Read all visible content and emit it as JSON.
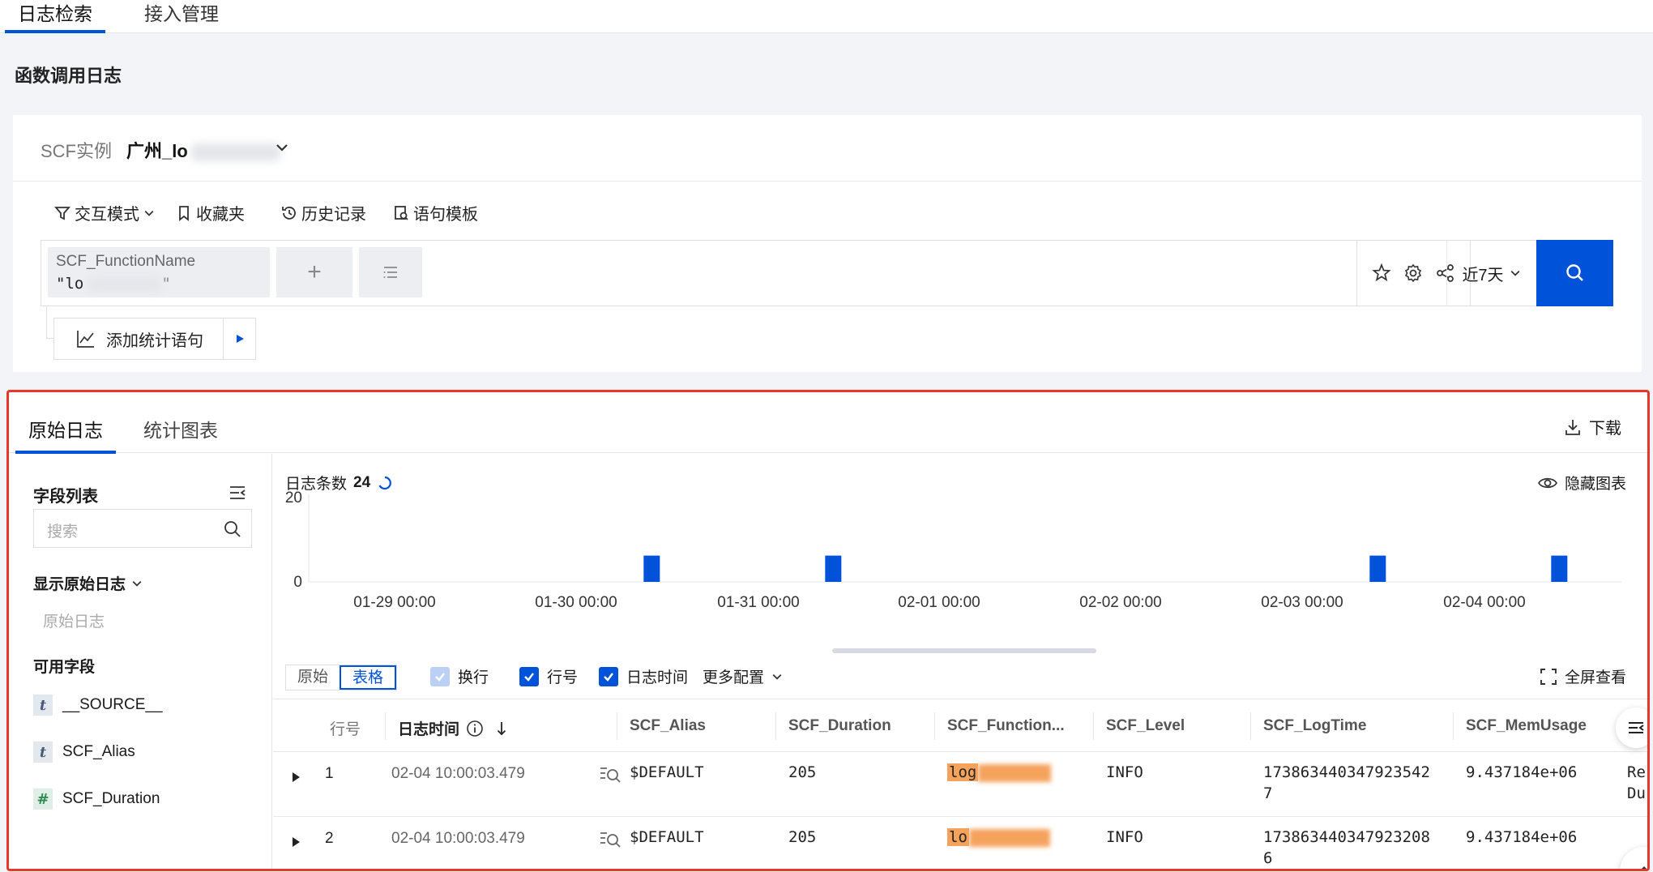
{
  "top_tabs": [
    {
      "label": "日志检索",
      "active": true
    },
    {
      "label": "接入管理",
      "active": false
    }
  ],
  "page_title": "函数调用日志",
  "instance": {
    "label": "SCF实例",
    "value": "广州_lo"
  },
  "toolbar": {
    "mode": "交互模式",
    "favorites": "收藏夹",
    "history": "历史记录",
    "templates": "语句模板"
  },
  "query": {
    "field_name": "SCF_FunctionName",
    "field_value": "\"lo",
    "add_symbol": "+",
    "time_range": "近7天",
    "add_stats": "添加统计语句"
  },
  "result_tabs": [
    {
      "label": "原始日志",
      "active": true
    },
    {
      "label": "统计图表",
      "active": false
    }
  ],
  "download": "下载",
  "sidebar": {
    "title": "字段列表",
    "search_placeholder": "搜索",
    "show_raw": "显示原始日志",
    "raw_log": "原始日志",
    "available": "可用字段",
    "fields": [
      {
        "type": "t",
        "name": "__SOURCE__"
      },
      {
        "type": "t",
        "name": "SCF_Alias"
      },
      {
        "type": "#",
        "name": "SCF_Duration"
      }
    ]
  },
  "summary": {
    "label": "日志条数",
    "count": "24"
  },
  "hide_chart": "隐藏图表",
  "chart_data": {
    "type": "bar",
    "y_ticks": [
      "20",
      "0"
    ],
    "ylim": [
      0,
      20
    ],
    "x_ticks": [
      "01-29 00:00",
      "01-30 00:00",
      "01-31 00:00",
      "02-01 00:00",
      "02-02 00:00",
      "02-03 00:00",
      "02-04 00:00"
    ],
    "bars": [
      {
        "x": "01-30 10:00",
        "value": 6
      },
      {
        "x": "01-31 10:00",
        "value": 6
      },
      {
        "x": "02-03 10:00",
        "value": 6
      },
      {
        "x": "02-04 10:00",
        "value": 6
      }
    ],
    "color": "#0052d9"
  },
  "view_options": {
    "raw": "原始",
    "table": "表格",
    "wrap": "换行",
    "line_no": "行号",
    "log_time": "日志时间",
    "more": "更多配置",
    "fullscreen": "全屏查看"
  },
  "table": {
    "columns": [
      "行号",
      "日志时间",
      "SCF_Alias",
      "SCF_Duration",
      "SCF_Function...",
      "SCF_Level",
      "SCF_LogTime",
      "SCF_MemUsage"
    ],
    "rows": [
      {
        "no": "1",
        "time": "02-04 10:00:03.479",
        "alias": "$DEFAULT",
        "duration": "205",
        "function": "log",
        "level": "INFO",
        "logtime_1": "173863440347923542",
        "logtime_2": "7",
        "mem": "9.437184e+06",
        "extra_1": "Re",
        "extra_2": "Du"
      },
      {
        "no": "2",
        "time": "02-04 10:00:03.479",
        "alias": "$DEFAULT",
        "duration": "205",
        "function": "lo",
        "level": "INFO",
        "logtime_1": "173863440347923208",
        "logtime_2": "6",
        "mem": "9.437184e+06",
        "extra_1": "",
        "extra_2": ""
      }
    ]
  },
  "colors": {
    "accent": "#0052d9",
    "highlight_border": "#e5372b",
    "field_highlight": "#f5a25d"
  }
}
